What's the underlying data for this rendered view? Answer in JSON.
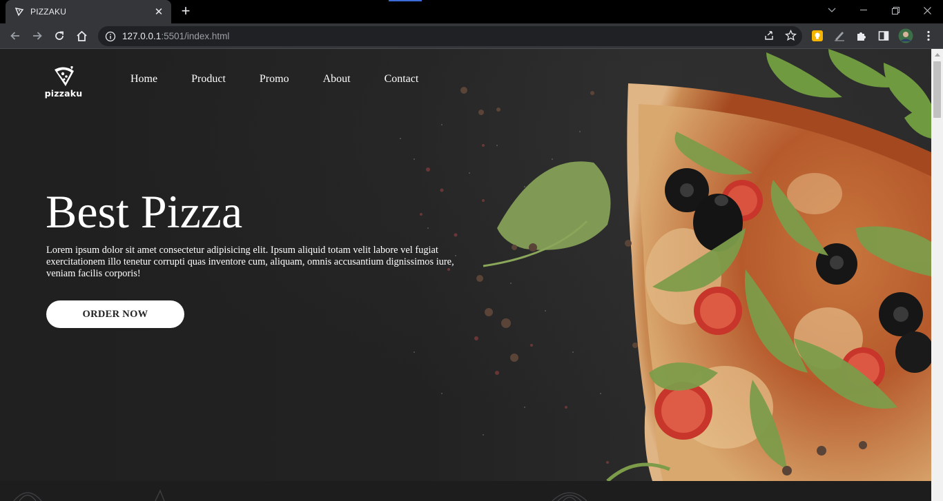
{
  "browser": {
    "tab": {
      "title": "PIZZAKU",
      "favicon_text": "pizzaku"
    },
    "url": {
      "host": "127.0.0.1",
      "rest": ":5501/index.html"
    },
    "icons": [
      "back-arrow-icon",
      "forward-arrow-icon",
      "reload-icon",
      "home-icon",
      "info-icon",
      "share-icon",
      "star-icon",
      "extension-icon",
      "puzzle-icon",
      "side-panel-icon",
      "profile-avatar",
      "menu-dots-icon"
    ]
  },
  "page": {
    "logo": {
      "text": "pizzaku"
    },
    "nav": [
      {
        "label": "Home"
      },
      {
        "label": "Product"
      },
      {
        "label": "Promo"
      },
      {
        "label": "About"
      },
      {
        "label": "Contact"
      }
    ],
    "hero": {
      "title": "Best Pizza",
      "description": "Lorem ipsum dolor sit amet consectetur adipisicing elit. Ipsum aliquid totam velit labore vel fugiat exercitationem illo tenetur corrupti quas inventore cum, aliquam, omnis accusantium dignissimos iure, veniam facilis corporis!",
      "cta": "ORDER NOW"
    }
  },
  "colors": {
    "background": "#222223",
    "text": "#ffffff",
    "button_bg": "#ffffff",
    "crust": "#c58a4f",
    "sauce": "#b8431f",
    "arugula": "#7d9c4a",
    "olive": "#1a1a1a",
    "tomato": "#c7352b"
  }
}
